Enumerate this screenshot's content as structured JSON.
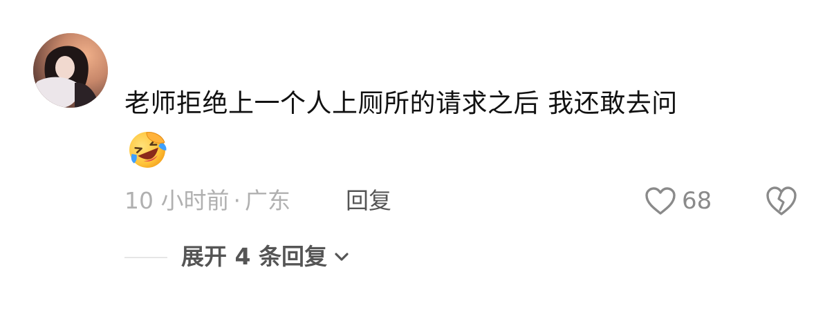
{
  "comment": {
    "text": "老师拒绝上一个人上厕所的请求之后 我还敢去问",
    "emoji": "laugh-crying-emoji",
    "time": "10 小时前",
    "separator": "·",
    "location": "广东",
    "reply_label": "回复",
    "like_count": "68",
    "expand_label": "展开 4 条回复"
  },
  "icons": {
    "like": "heart-outline-icon",
    "dislike": "broken-heart-icon",
    "expand": "chevron-down-icon"
  },
  "colors": {
    "text": "#111111",
    "meta": "#b0b0b0",
    "action": "#555555",
    "icon": "#8a8a8a"
  }
}
